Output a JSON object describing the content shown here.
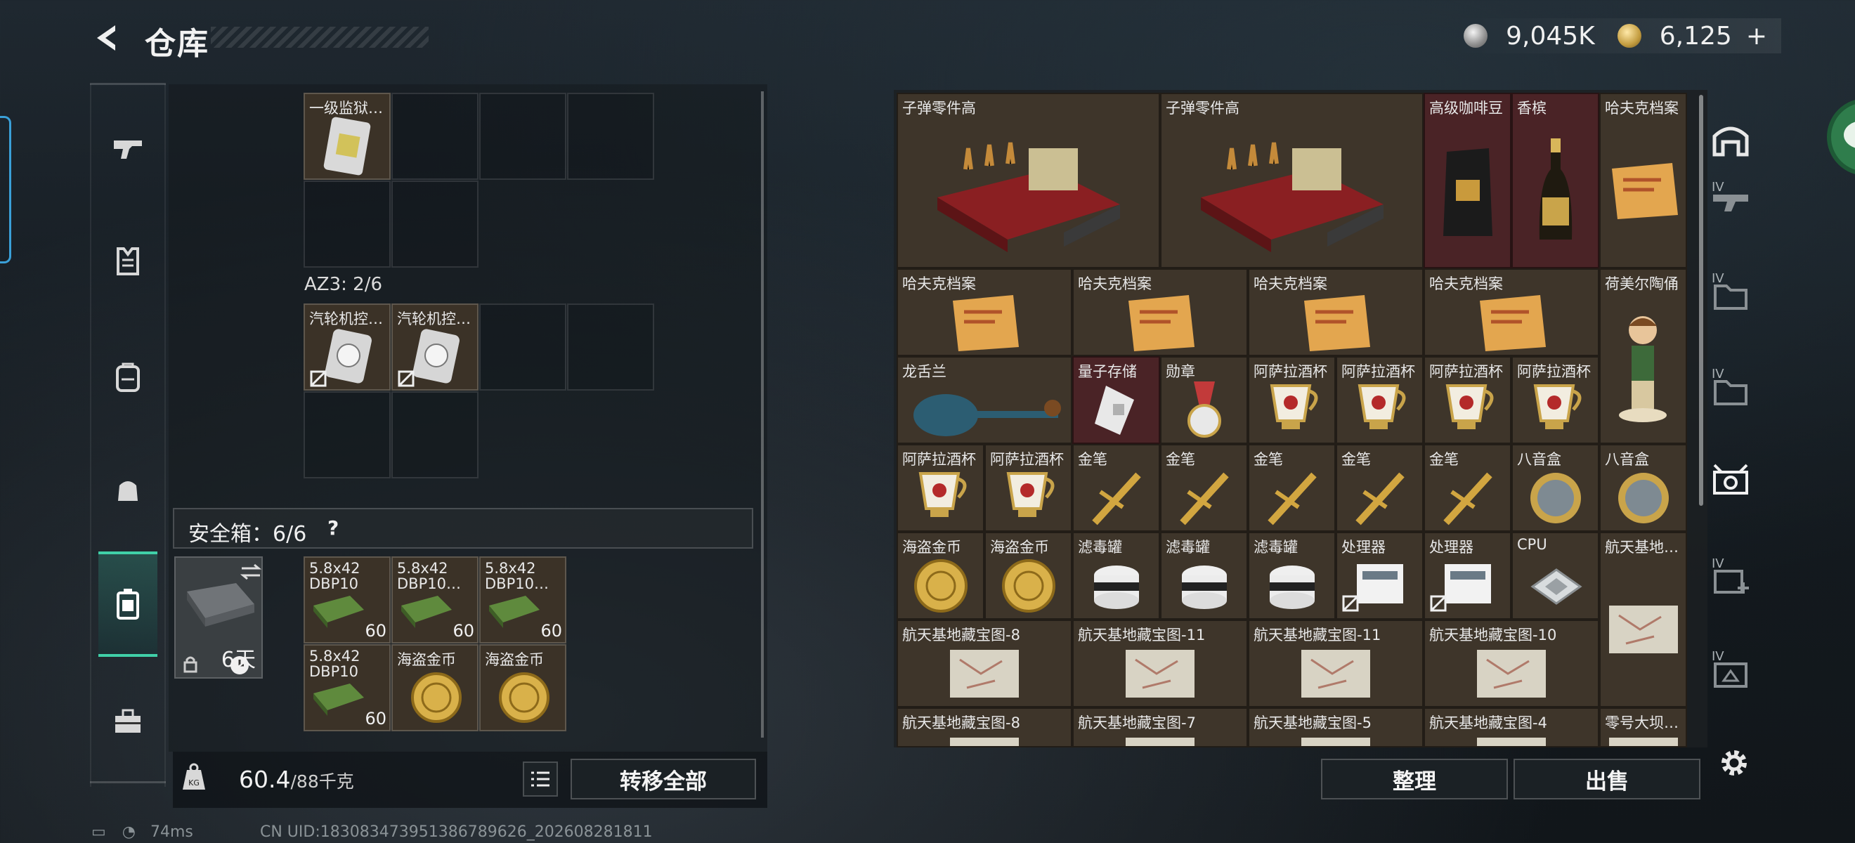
{
  "header": {
    "title": "仓库"
  },
  "currency": {
    "silver": "9,045K",
    "gold": "6,125",
    "gold_plus": "+"
  },
  "left": {
    "top_item": "一级监狱…",
    "az3_label": "AZ3: 2/6",
    "az3_items": [
      "汽轮机控…",
      "汽轮机控…"
    ],
    "safe_label": "安全箱：6/6",
    "safe_help": "?",
    "case_days": "6天",
    "safe_items": [
      {
        "name": "5.8x42 DBP10",
        "count": "60"
      },
      {
        "name": "5.8x42 DBP10…",
        "count": "60"
      },
      {
        "name": "5.8x42 DBP10…",
        "count": "60"
      },
      {
        "name": "5.8x42 DBP10",
        "count": "60"
      },
      {
        "name": "海盗金币",
        "count": ""
      },
      {
        "name": "海盗金币",
        "count": ""
      }
    ],
    "weight_value": "60.4",
    "weight_max": "/88千克",
    "transfer_all": "转移全部"
  },
  "right": {
    "items": [
      "子弹零件高",
      "子弹零件高",
      "高级咖啡豆",
      "香槟",
      "哈夫克档案",
      "哈夫克档案",
      "哈夫克档案",
      "哈夫克档案",
      "哈夫克档案",
      "荷美尔陶俑",
      "龙舌兰",
      "量子存储",
      "勋章",
      "阿萨拉酒杯",
      "阿萨拉酒杯",
      "阿萨拉酒杯",
      "阿萨拉酒杯",
      "阿萨拉酒杯",
      "阿萨拉酒杯",
      "金笔",
      "金笔",
      "金笔",
      "金笔",
      "金笔",
      "八音盒",
      "八音盒",
      "海盗金币",
      "海盗金币",
      "滤毒罐",
      "滤毒罐",
      "滤毒罐",
      "处理器",
      "处理器",
      "CPU",
      "航天基地…",
      "航天基地藏宝图-8",
      "航天基地藏宝图-11",
      "航天基地藏宝图-11",
      "航天基地藏宝图-10",
      "航天基地藏宝图-8",
      "航天基地藏宝图-7",
      "航天基地藏宝图-5",
      "航天基地藏宝图-4",
      "零号大坝…"
    ],
    "organize": "整理",
    "sell": "出售"
  },
  "status": {
    "ping": "74ms",
    "uid": "CN UID:1830834739513867896​26_202608281811"
  },
  "tabs": {
    "iv": "IV"
  }
}
